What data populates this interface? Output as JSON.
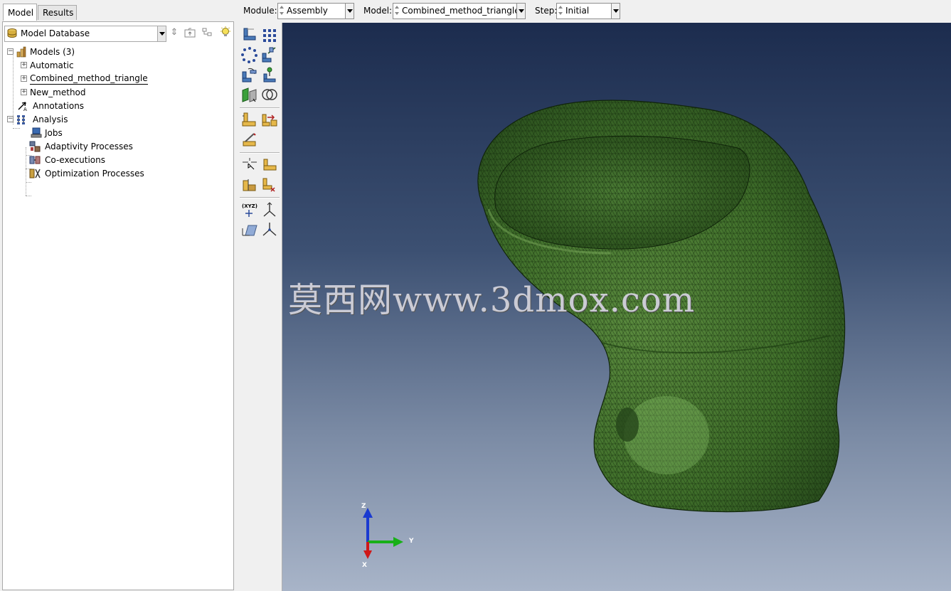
{
  "left_panel": {
    "tabs": [
      {
        "label": "Model",
        "active": true
      },
      {
        "label": "Results",
        "active": false
      }
    ],
    "database_selector": {
      "value": "Model Database"
    },
    "tree": {
      "models": {
        "label": "Models (3)"
      },
      "model_items": [
        {
          "label": "Automatic"
        },
        {
          "label": "Combined_method_triangle",
          "current": true
        },
        {
          "label": "New_method"
        }
      ],
      "annotations": {
        "label": "Annotations"
      },
      "analysis": {
        "label": "Analysis"
      },
      "analysis_items": [
        {
          "label": "Jobs",
          "icon": "jobs-icon"
        },
        {
          "label": "Adaptivity Processes",
          "icon": "adaptivity-icon"
        },
        {
          "label": "Co-executions",
          "icon": "co-execution-icon"
        },
        {
          "label": "Optimization Processes",
          "icon": "optimization-icon"
        }
      ]
    }
  },
  "context_bar": {
    "module": {
      "label": "Module:",
      "value": "Assembly"
    },
    "model": {
      "label": "Model:",
      "value": "Combined_method_triangle"
    },
    "step": {
      "label": "Step:",
      "value": "Initial"
    }
  },
  "viewport": {
    "watermark": "莫西网www.3dmox.com",
    "triad": {
      "x_label": "X",
      "y_label": "Y",
      "z_label": "Z"
    },
    "mesh_color": "#3f6e2a",
    "background_top": "#1c2c4e",
    "background_bottom": "#a8b4c8"
  }
}
